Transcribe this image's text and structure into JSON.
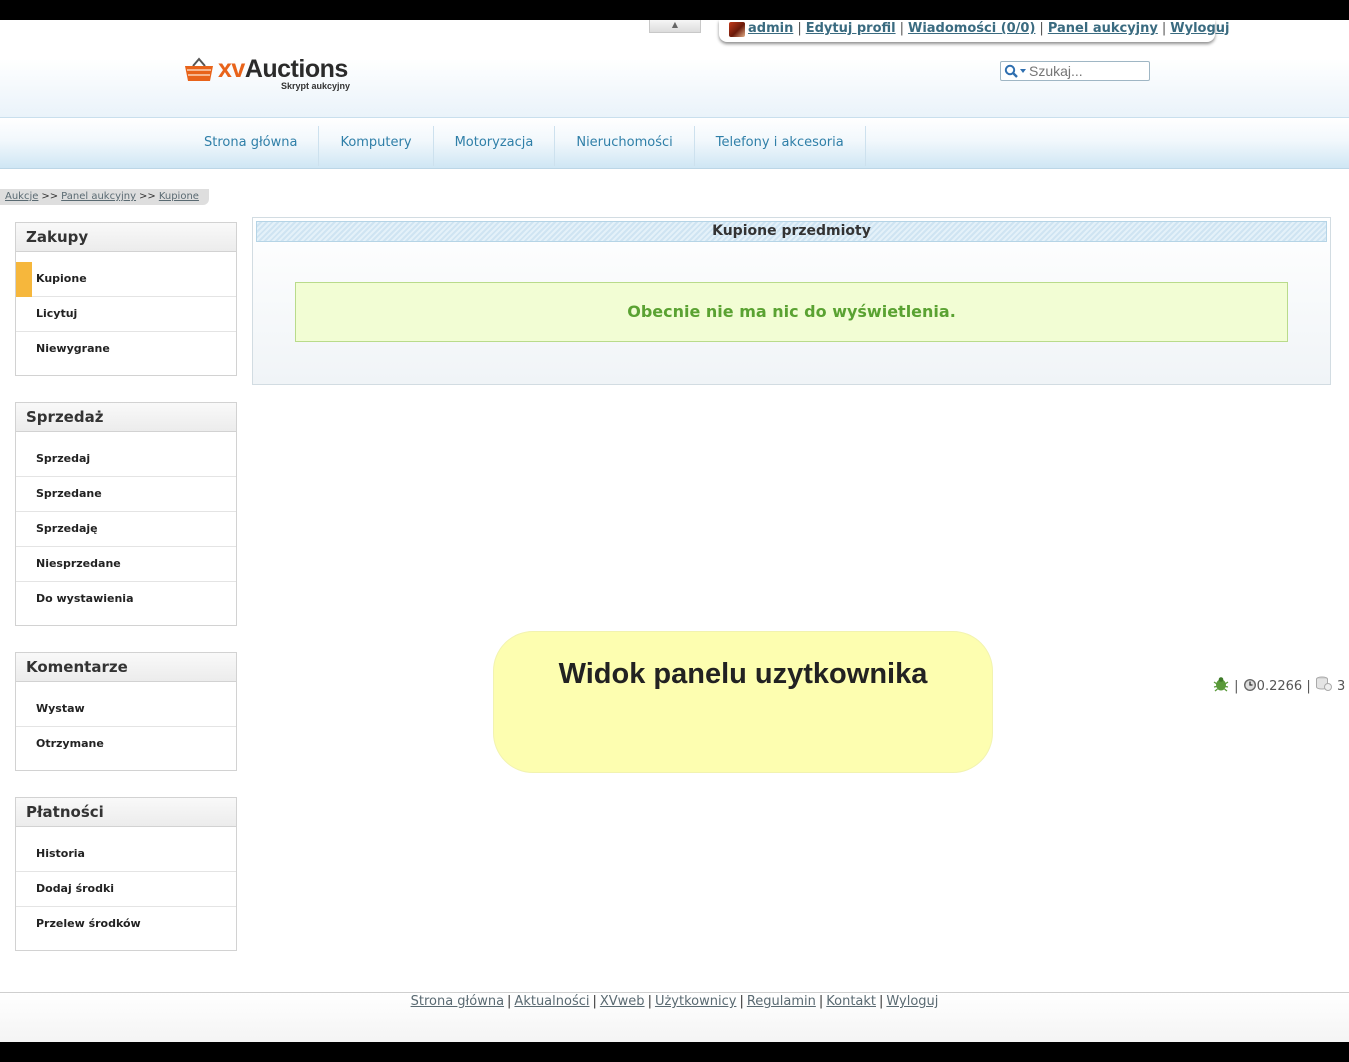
{
  "header": {
    "toggle_symbol": "▲",
    "user": {
      "username": "admin",
      "links": [
        "Edytuj profil",
        "Wiadomości (0/0)",
        "Panel aukcyjny",
        "Wyloguj"
      ],
      "separator": "|"
    },
    "logo": {
      "brand_prefix": "xv",
      "brand_name": "Auctions",
      "tagline": "Skrypt aukcyjny"
    },
    "search": {
      "placeholder": "Szukaj..."
    }
  },
  "nav": {
    "items": [
      "Strona główna",
      "Komputery",
      "Motoryzacja",
      "Nieruchomości",
      "Telefony i akcesoria"
    ]
  },
  "breadcrumb": {
    "items": [
      "Aukcje",
      "Panel aukcyjny",
      "Kupione"
    ],
    "separator": ">>"
  },
  "sidebar": {
    "sections": [
      {
        "title": "Zakupy",
        "items": [
          "Kupione",
          "Licytuj",
          "Niewygrane"
        ],
        "active": "Kupione"
      },
      {
        "title": "Sprzedaż",
        "items": [
          "Sprzedaj",
          "Sprzedane",
          "Sprzedaję",
          "Niesprzedane",
          "Do wystawienia"
        ]
      },
      {
        "title": "Komentarze",
        "items": [
          "Wystaw",
          "Otrzymane"
        ]
      },
      {
        "title": "Płatności",
        "items": [
          "Historia",
          "Dodaj środki",
          "Przelew środków"
        ]
      }
    ]
  },
  "main": {
    "panel_title": "Kupione przedmioty",
    "empty_message": "Obecnie nie ma nic do wyświetlenia."
  },
  "stats": {
    "time": "0.2266",
    "queries": "3",
    "separator": "|"
  },
  "callout": {
    "text": "Widok panelu uzytkownika"
  },
  "footer": {
    "links": [
      "Strona główna",
      "Aktualności",
      "XVweb",
      "Użytkownicy",
      "Regulamin",
      "Kontakt",
      "Wyloguj"
    ],
    "separator": "|"
  },
  "colors": {
    "accent_orange": "#f6b73c",
    "nav_text": "#2f7fa8",
    "notice_green": "#5aa232",
    "callout_bg": "#fdfeb0"
  },
  "icons": [
    "user-avatar-icon",
    "search-icon",
    "basket-logo-icon",
    "bug-icon",
    "clock-icon",
    "database-icon"
  ]
}
